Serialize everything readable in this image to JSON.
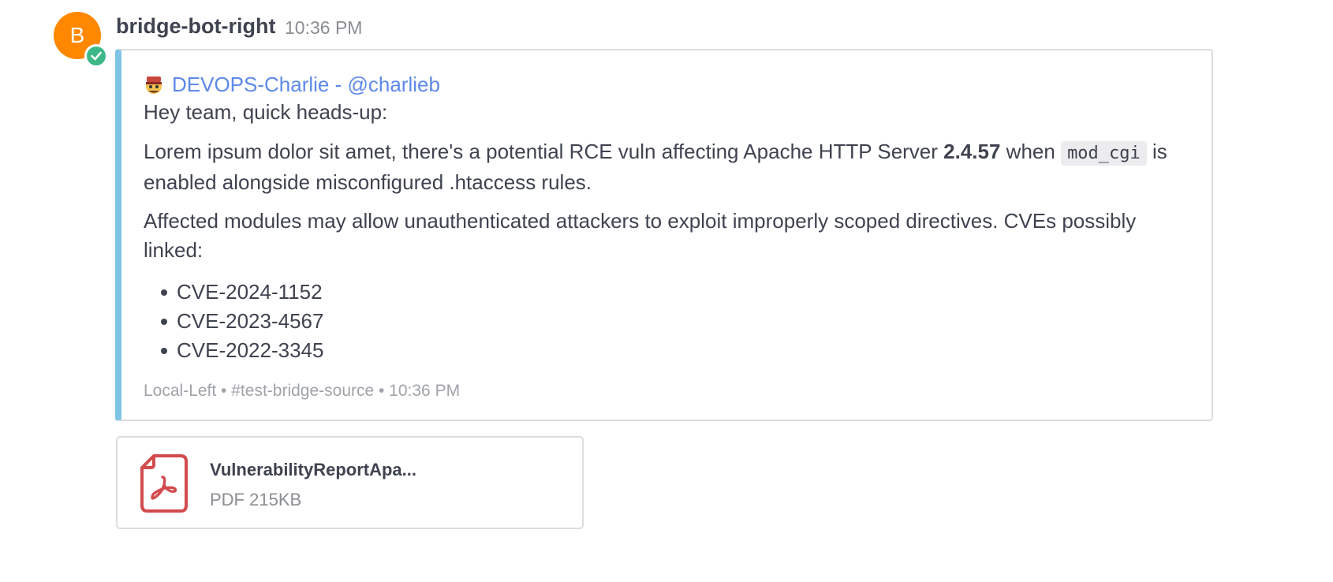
{
  "post": {
    "avatar_initial": "B",
    "username": "bridge-bot-right",
    "time": "10:36 PM"
  },
  "attachment": {
    "accent_color": "#7ec4e4",
    "author": "DEVOPS-Charlie - @charlieb",
    "author_icon": "bandit-emoji-icon",
    "greeting": "Hey team, quick heads-up:",
    "p1_before": "Lorem ipsum dolor sit amet, there's a potential RCE vuln affecting Apache HTTP Server ",
    "p1_version": "2.4.57",
    "p1_when": " when ",
    "p1_code": "mod_cgi",
    "p1_after": " is enabled alongside misconfigured .htaccess rules.",
    "p2": "Affected modules may allow unauthenticated attackers to exploit improperly scoped directives. CVEs possibly linked:",
    "cves": [
      "CVE-2024-1152",
      "CVE-2023-4567",
      "CVE-2022-3345"
    ],
    "footer": "Local-Left • #test-bridge-source • 10:36 PM"
  },
  "file": {
    "icon": "pdf-file-icon",
    "name": "VulnerabilityReportApa...",
    "meta": "PDF 215KB"
  },
  "colors": {
    "avatar": "#ff8800",
    "verified_badge": "#3db887",
    "link": "#5d89ea",
    "pdf_icon": "#d24b4e"
  }
}
